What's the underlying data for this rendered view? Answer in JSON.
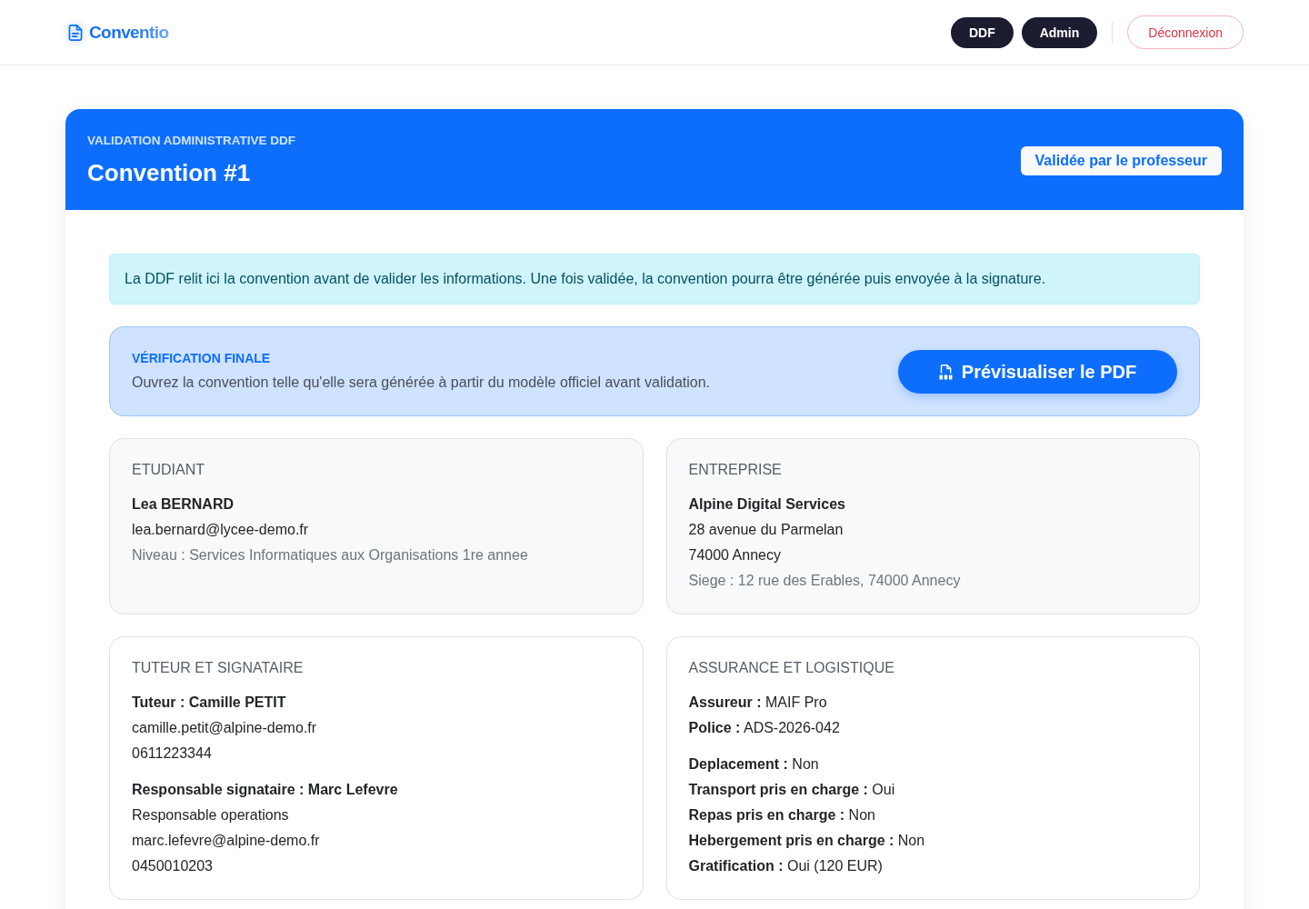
{
  "brand": {
    "name": "Conventio"
  },
  "nav_buttons": [
    {
      "label": "DDF",
      "kind": "role"
    },
    {
      "label": "Admin",
      "kind": "role"
    },
    {
      "label": "Déconnexion",
      "kind": "logout"
    }
  ],
  "convention_header": {
    "eyebrow": "VALIDATION ADMINISTRATIVE DDF",
    "title": "Convention #1",
    "status_badge": "Validée par le professeur"
  },
  "info_alert": "La DDF relit ici la convention avant de valider les informations. Une fois validée, la convention pourra être générée puis envoyée à la signature.",
  "final_check": {
    "eyebrow": "VÉRIFICATION FINALE",
    "text": "Ouvrez la convention telle qu'elle sera générée à partir du modèle officiel avant validation.",
    "button": "Prévisualiser le PDF"
  },
  "cards": [
    {
      "title": "ETUDIANT",
      "kind": "tinted",
      "sections": [
        {
          "lines": [
            {
              "kind": "bold",
              "text": "Lea BERNARD"
            },
            {
              "kind": "plain",
              "text": "lea.bernard@lycee-demo.fr"
            },
            {
              "kind": "muted",
              "text": "Niveau : Services Informatiques aux Organisations 1re annee"
            }
          ]
        }
      ]
    },
    {
      "title": "ENTREPRISE",
      "kind": "tinted",
      "sections": [
        {
          "lines": [
            {
              "kind": "bold",
              "text": "Alpine Digital Services"
            },
            {
              "kind": "plain",
              "text": "28 avenue du Parmelan"
            },
            {
              "kind": "plain",
              "text": "74000 Annecy"
            },
            {
              "kind": "muted",
              "text": "Siege : 12 rue des Erables, 74000 Annecy"
            }
          ]
        }
      ]
    },
    {
      "title": "TUTEUR ET SIGNATAIRE",
      "kind": "plain",
      "sections": [
        {
          "lines": [
            {
              "kind": "bold",
              "text": "Tuteur : Camille PETIT"
            },
            {
              "kind": "plain",
              "text": "camille.petit@alpine-demo.fr"
            },
            {
              "kind": "plain",
              "text": "0611223344"
            }
          ]
        },
        {
          "lines": [
            {
              "kind": "bold",
              "text": "Responsable signataire : Marc Lefevre"
            },
            {
              "kind": "plain",
              "text": "Responsable operations"
            },
            {
              "kind": "plain",
              "text": "marc.lefevre@alpine-demo.fr"
            },
            {
              "kind": "plain",
              "text": "0450010203"
            }
          ]
        }
      ]
    },
    {
      "title": "ASSURANCE ET LOGISTIQUE",
      "kind": "plain",
      "sections": [
        {
          "lines": [
            {
              "kind": "plain",
              "text": "**Assureur :** MAIF Pro"
            },
            {
              "kind": "plain",
              "text": "**Police :** ADS-2026-042"
            }
          ]
        },
        {
          "lines": [
            {
              "kind": "plain",
              "text": "**Deplacement :** Non"
            },
            {
              "kind": "plain",
              "text": "**Transport pris en charge :** Oui"
            },
            {
              "kind": "plain",
              "text": "**Repas pris en charge :** Non"
            },
            {
              "kind": "plain",
              "text": "**Hebergement pris en charge :** Non"
            },
            {
              "kind": "plain",
              "text": "**Gratification :** Oui (120 EUR)"
            }
          ]
        }
      ]
    }
  ]
}
